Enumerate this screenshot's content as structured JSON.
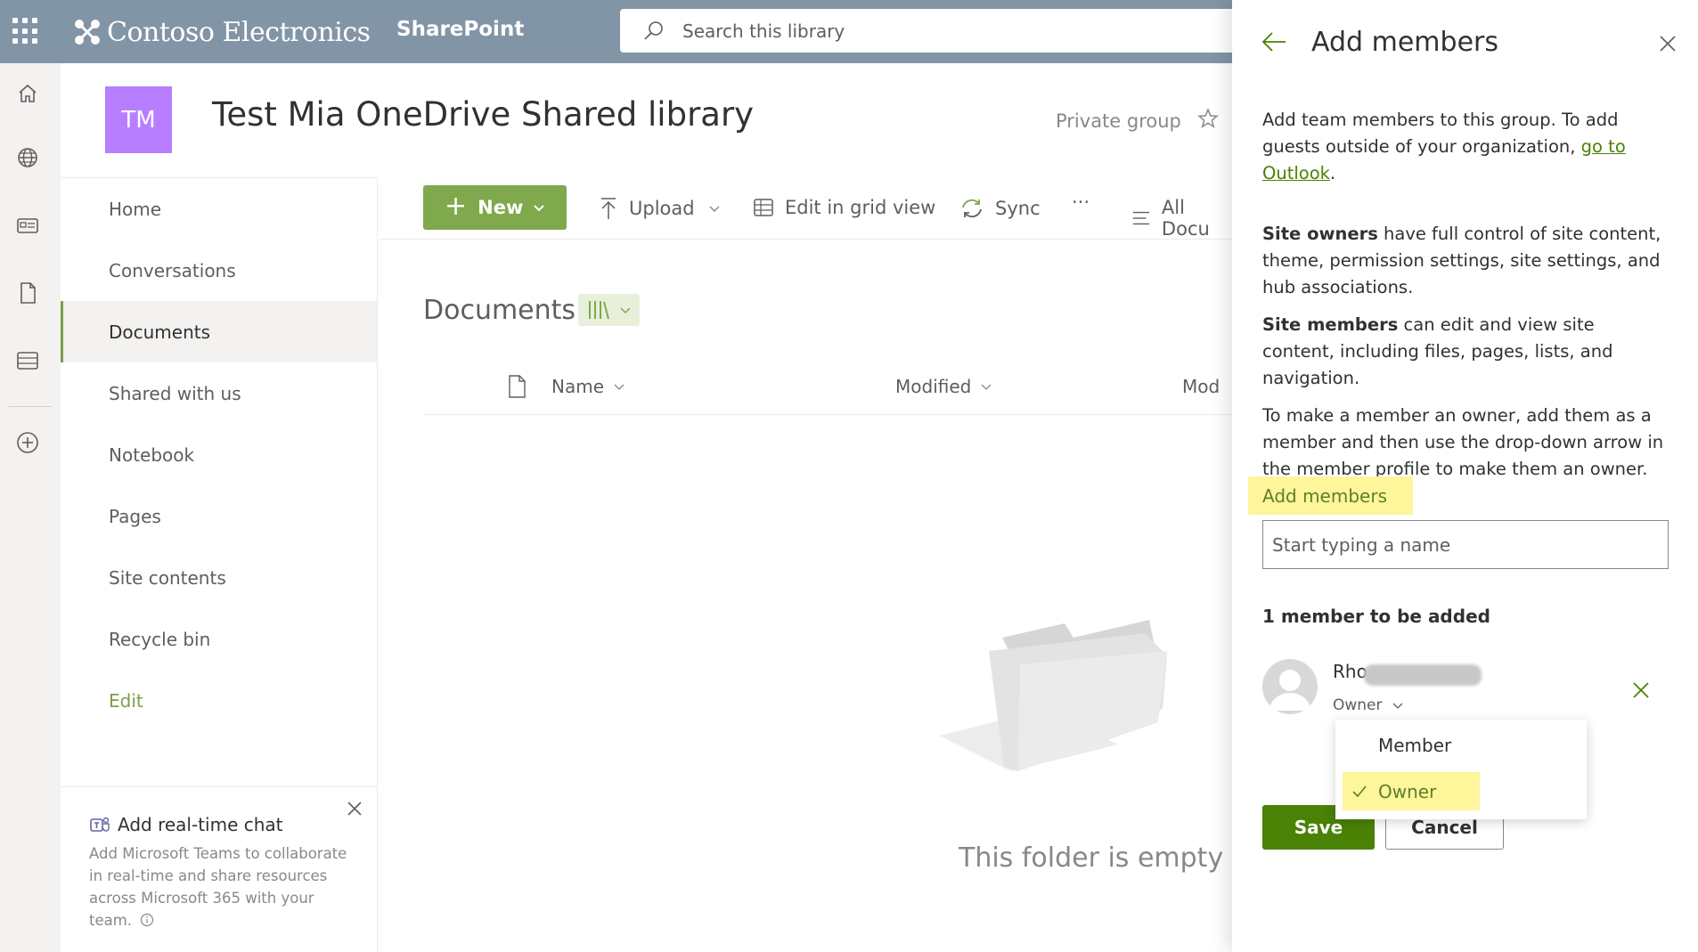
{
  "suite_bar": {
    "brand": "Contoso Electronics",
    "app_name": "SharePoint",
    "search_placeholder": "Search this library"
  },
  "site": {
    "logo_initials": "TM",
    "title": "Test Mia OneDrive Shared library",
    "privacy": "Private group"
  },
  "nav": {
    "items": [
      {
        "label": "Home"
      },
      {
        "label": "Conversations"
      },
      {
        "label": "Documents",
        "active": true
      },
      {
        "label": "Shared with us"
      },
      {
        "label": "Notebook"
      },
      {
        "label": "Pages"
      },
      {
        "label": "Site contents"
      },
      {
        "label": "Recycle bin"
      }
    ],
    "edit_label": "Edit"
  },
  "chat_card": {
    "title": "Add real-time chat",
    "description": "Add Microsoft Teams to collaborate in real-time and share resources across Microsoft 365 with your team."
  },
  "command_bar": {
    "new_label": "New",
    "upload_label": "Upload",
    "grid_label": "Edit in grid view",
    "sync_label": "Sync",
    "more_label": "···",
    "view_label": "All Docu"
  },
  "library": {
    "title": "Documents",
    "columns": {
      "name": "Name",
      "modified": "Modified",
      "modified_by": "Mod"
    },
    "empty_message": "This folder is empty"
  },
  "panel": {
    "title": "Add members",
    "intro_text": "Add team members to this group. To add guests outside of your organization, ",
    "intro_link": "go to Outlook",
    "intro_end": ".",
    "owners_bold": "Site owners",
    "owners_text": " have full control of site content, theme, permission settings, site settings, and hub associations.",
    "members_bold": "Site members",
    "members_text": " can edit and view site content, including files, pages, lists, and navigation.",
    "owner_howto": "To make a member an owner, add them as a member and then use the drop-down arrow in the member profile to make them an owner.",
    "field_label": "Add members",
    "input_placeholder": "Start typing a name",
    "count_label": "1 member to be added",
    "member": {
      "name": "Rho",
      "role": "Owner"
    },
    "role_options": [
      "Member",
      "Owner"
    ],
    "selected_role": "Owner",
    "save_label": "Save",
    "cancel_label": "Cancel"
  },
  "colors": {
    "suite_bar": "#8295a6",
    "accent": "#7fa94c",
    "save_button": "#498205",
    "site_logo": "#b77fff",
    "highlight": "#fff59a"
  }
}
